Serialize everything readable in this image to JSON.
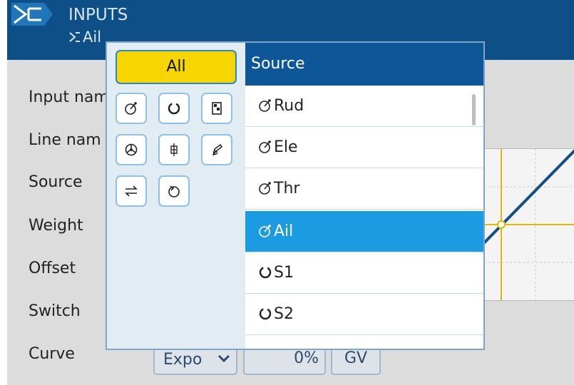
{
  "header": {
    "title": "INPUTS",
    "subtitle": "Ail",
    "icon": "inputs-icon"
  },
  "form": {
    "labels": [
      "Input nam",
      "Line nam",
      "Source",
      "Weight",
      "Offset",
      "Switch",
      "Curve"
    ],
    "curve": {
      "type_value": "Expo",
      "amount_value": "0%",
      "gv_label": "GV"
    }
  },
  "popup": {
    "all_label": "All",
    "filter_icons": [
      "stick-icon",
      "pot-icon",
      "slider-icon",
      "trainer-icon",
      "logical-switch-icon",
      "gyro-icon",
      "channel-icon",
      "trim-icon"
    ],
    "list_header": "Source",
    "items": [
      {
        "label": "Rud",
        "icon": "stick-icon",
        "selected": false
      },
      {
        "label": "Ele",
        "icon": "stick-icon",
        "selected": false
      },
      {
        "label": "Thr",
        "icon": "stick-icon",
        "selected": false
      },
      {
        "label": "Ail",
        "icon": "stick-icon",
        "selected": true
      },
      {
        "label": "S1",
        "icon": "pot-icon",
        "selected": false
      },
      {
        "label": "S2",
        "icon": "pot-icon",
        "selected": false
      }
    ]
  },
  "colors": {
    "header_bg": "#0d4f86",
    "selected_row": "#1a9be2",
    "all_button": "#f7d600",
    "list_header_bg": "#0d5698",
    "curve_line": "#0d4f86"
  }
}
